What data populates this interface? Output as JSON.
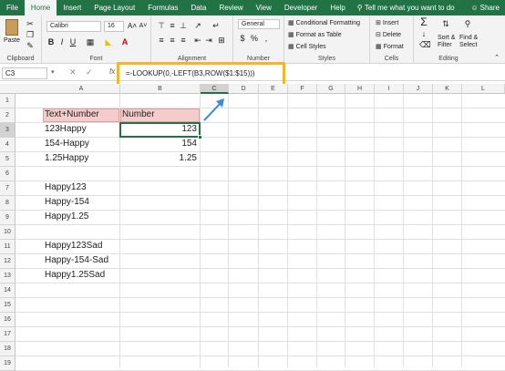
{
  "tabs": [
    "File",
    "Home",
    "Insert",
    "Page Layout",
    "Formulas",
    "Data",
    "Review",
    "View",
    "Developer",
    "Help"
  ],
  "tell": "Tell me what you want to do",
  "share": "Share",
  "ribbon": {
    "clipboard": {
      "label": "Clipboard",
      "paste": "Paste"
    },
    "font": {
      "label": "Font",
      "name": "Calibri",
      "size": "16",
      "bold": "B",
      "italic": "I",
      "underline": "U"
    },
    "alignment": {
      "label": "Alignment"
    },
    "number": {
      "label": "Number",
      "format": "General",
      "currency": "$",
      "percent": "%",
      "comma": ","
    },
    "styles": {
      "label": "Styles",
      "conditional": "Conditional Formatting",
      "table": "Format as Table",
      "cell": "Cell Styles"
    },
    "cells": {
      "label": "Cells",
      "insert": "Insert",
      "delete": "Delete",
      "format": "Format"
    },
    "editing": {
      "label": "Editing",
      "sort": "Sort &",
      "sort2": "Filter",
      "find": "Find &",
      "find2": "Select"
    }
  },
  "formula_bar": {
    "namebox": "C3",
    "fx": "fx",
    "formula": "=-LOOKUP(0,-LEFT(B3,ROW($1:$15)))"
  },
  "columns": [
    "A",
    "B",
    "C",
    "D",
    "E",
    "F",
    "G",
    "H",
    "I",
    "J",
    "K",
    "L"
  ],
  "rows": [
    "1",
    "2",
    "3",
    "4",
    "5",
    "6",
    "7",
    "8",
    "9",
    "10",
    "11",
    "12",
    "13",
    "14",
    "15",
    "16",
    "17",
    "18",
    "19"
  ],
  "cells": {
    "b2": "Text+Number",
    "c2": "Number",
    "b3": "123Happy",
    "c3": "123",
    "b4": "154-Happy",
    "c4": "154",
    "b5": "1.25Happy",
    "c5": "1.25",
    "b7": "Happy123",
    "b8": "Happy-154",
    "b9": "Happy1.25",
    "b11": "Happy123Sad",
    "b12": "Happy-154-Sad",
    "b13": "Happy1.25Sad"
  },
  "colors": {
    "excel_green": "#217346",
    "header_fill": "#f4cccc",
    "highlight": "#f5b42a",
    "arrow": "#3b8bd6"
  }
}
